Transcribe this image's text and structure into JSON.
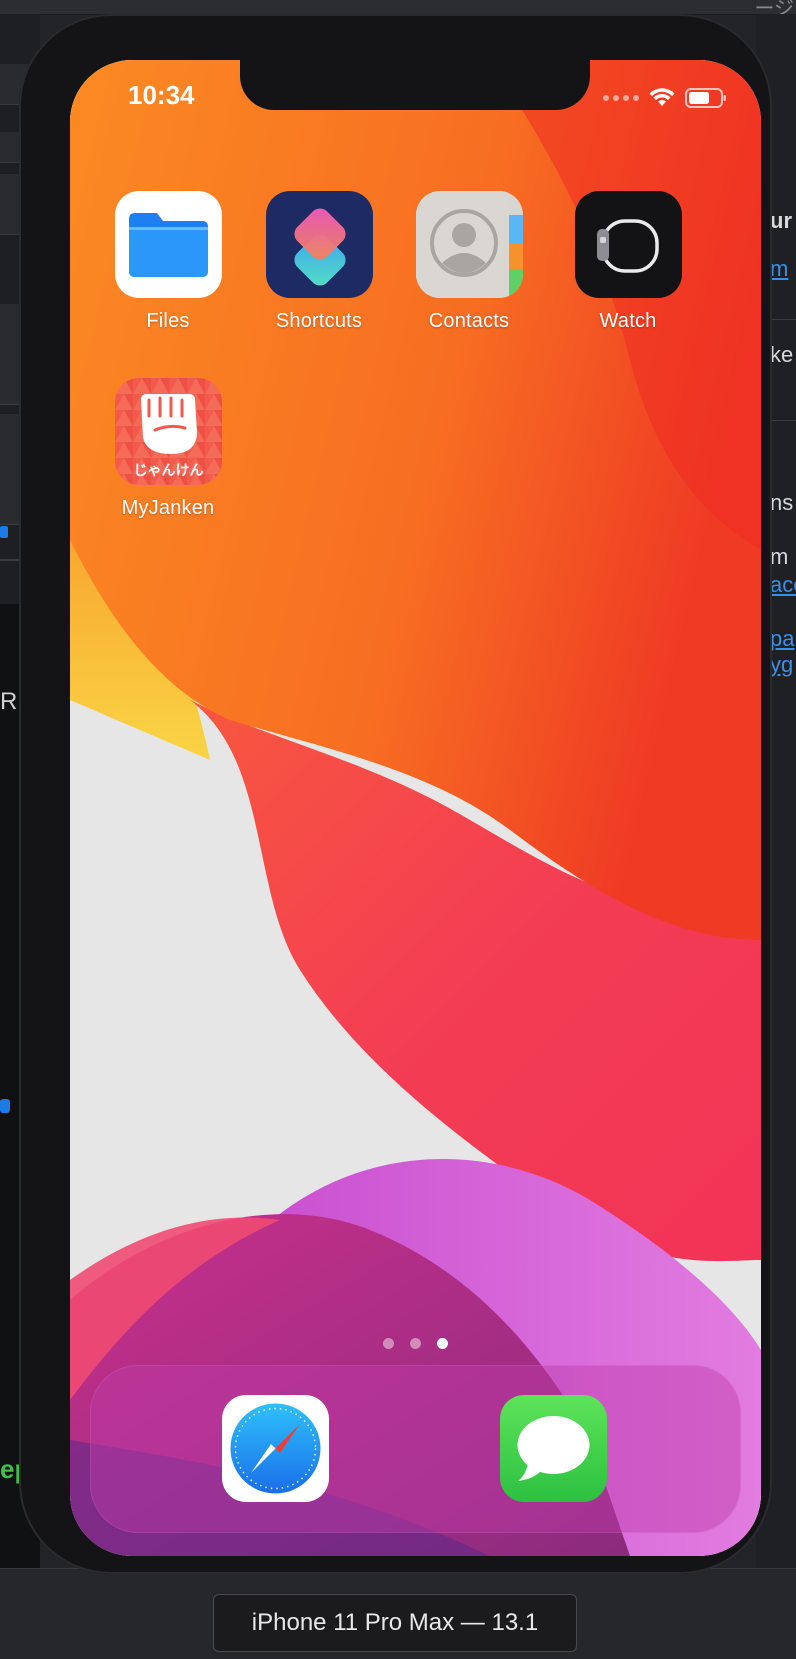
{
  "device": {
    "model_label": "iPhone 11 Pro Max — 13.1"
  },
  "status_bar": {
    "time": "10:34",
    "icons": [
      "cellular-dots-icon",
      "wifi-icon",
      "battery-icon"
    ]
  },
  "home_screen": {
    "apps": [
      {
        "name": "Files",
        "icon": "files-folder-icon"
      },
      {
        "name": "Shortcuts",
        "icon": "shortcuts-icon"
      },
      {
        "name": "Contacts",
        "icon": "contacts-icon"
      },
      {
        "name": "Watch",
        "icon": "watch-icon"
      },
      {
        "name": "MyJanken",
        "icon": "janken-fist-icon",
        "icon_text": "じゃんけん"
      }
    ],
    "page_indicator": {
      "pages": 3,
      "current": 3
    }
  },
  "dock": {
    "apps": [
      {
        "name": "Safari",
        "icon": "safari-compass-icon"
      },
      {
        "name": "Messages",
        "icon": "messages-bubble-icon"
      }
    ]
  },
  "background_window": {
    "topbar_text": "ージ",
    "right_panel_fragments": [
      "ur",
      "m",
      "ke",
      "ns",
      "m",
      "ace",
      "pa",
      "yg"
    ],
    "left_panel_fragments": [
      "R",
      "ep"
    ]
  },
  "colors": {
    "wallpaper_orange": "#f97a22",
    "wallpaper_red": "#ee2a2a",
    "wallpaper_pink": "#f4356a",
    "wallpaper_magenta": "#d04ea0",
    "wallpaper_yellow": "#f7c63b",
    "wallpaper_light": "#e6e6e6",
    "files_blue": "#1f8df5",
    "messages_green": "#3ccf4e"
  }
}
